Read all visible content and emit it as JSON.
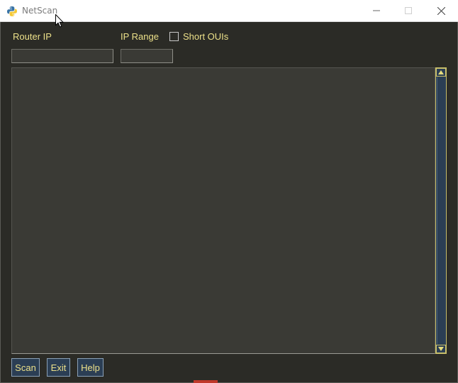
{
  "window": {
    "title": "NetScan",
    "controls": [
      "minimize-icon",
      "maximize-icon",
      "close-icon"
    ]
  },
  "form": {
    "router_ip_label": "Router IP",
    "router_ip_value": "",
    "ip_range_label": "IP Range",
    "ip_range_value": "",
    "short_ouis_label": "Short OUIs",
    "short_ouis_checked": false
  },
  "output": {
    "text": ""
  },
  "buttons": {
    "scan": "Scan",
    "exit": "Exit",
    "help": "Help"
  },
  "colors": {
    "background": "#2b2b26",
    "text_accent": "#ece089",
    "field_bg": "#3a3a35",
    "button_bg": "#2b3e54"
  }
}
